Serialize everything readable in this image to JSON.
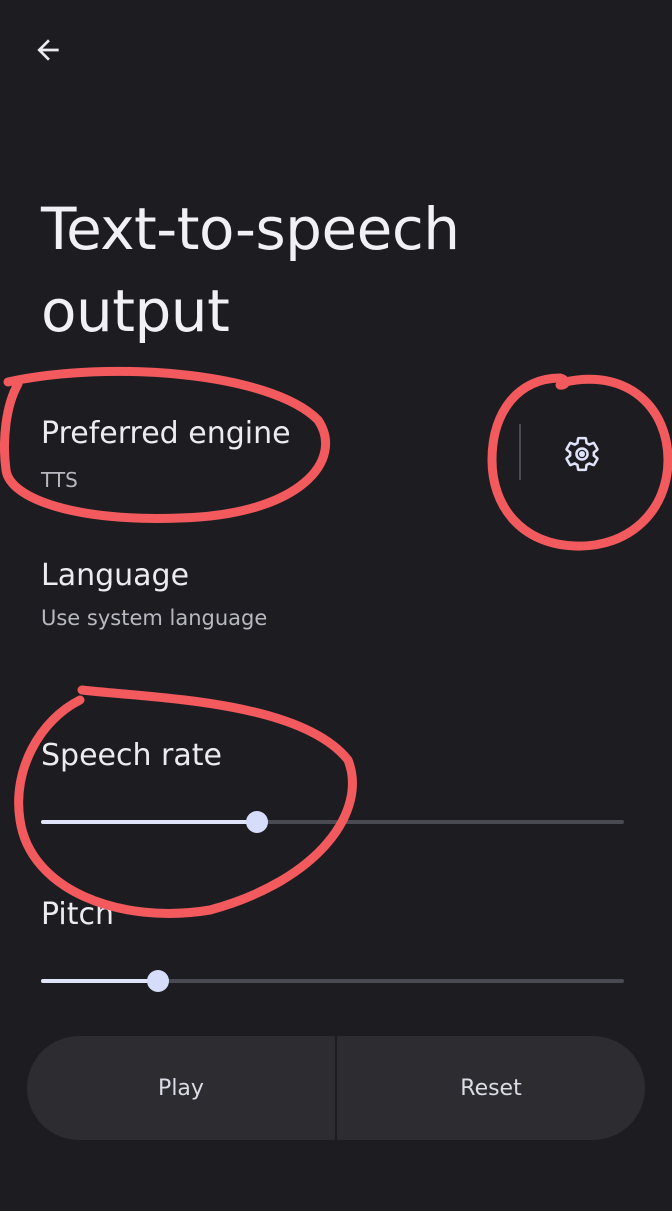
{
  "header": {
    "back_icon": "arrow-left-icon"
  },
  "page": {
    "title": "Text-to-speech output"
  },
  "preferred_engine": {
    "label": "Preferred engine",
    "value": "TTS",
    "settings_icon": "gear-icon"
  },
  "language": {
    "label": "Language",
    "value": "Use system language"
  },
  "speech_rate": {
    "label": "Speech rate",
    "level": 0.37
  },
  "pitch": {
    "label": "Pitch",
    "level": 0.2
  },
  "actions": {
    "play_label": "Play",
    "reset_label": "Reset"
  },
  "colors": {
    "background": "#1d1d21",
    "slider_active": "#dfe4fa",
    "slider_inactive": "#4a4a52",
    "button_bg": "#2c2c31",
    "annotation_red": "#f25a5e"
  }
}
